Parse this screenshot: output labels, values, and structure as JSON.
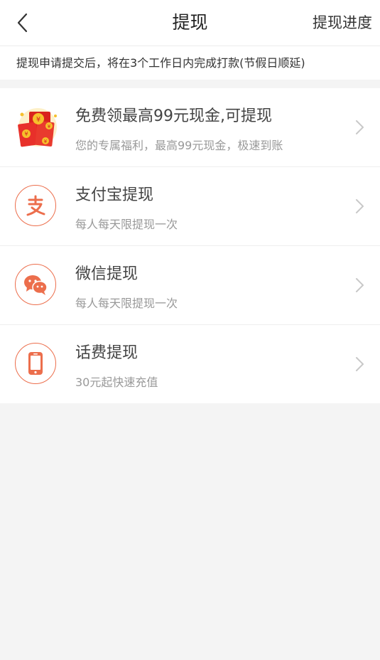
{
  "header": {
    "title": "提现",
    "action_label": "提现进度"
  },
  "notice": {
    "text": "提现申请提交后，将在3个工作日内完成打款(节假日顺延)"
  },
  "options": [
    {
      "title": "免费领最高99元现金,可提现",
      "subtitle": "您的专属福利，最高99元现金，极速到账",
      "icon": "red-envelope-icon"
    },
    {
      "title": "支付宝提现",
      "subtitle": "每人每天限提现一次",
      "icon": "alipay-icon"
    },
    {
      "title": "微信提现",
      "subtitle": "每人每天限提现一次",
      "icon": "wechat-icon"
    },
    {
      "title": "话费提现",
      "subtitle": "30元起快速充值",
      "icon": "phone-icon"
    }
  ],
  "colors": {
    "accent": "#ec6e4c",
    "background": "#f4f4f4",
    "envelope_red": "#e8302a",
    "coin_gold": "#f6c02b"
  }
}
